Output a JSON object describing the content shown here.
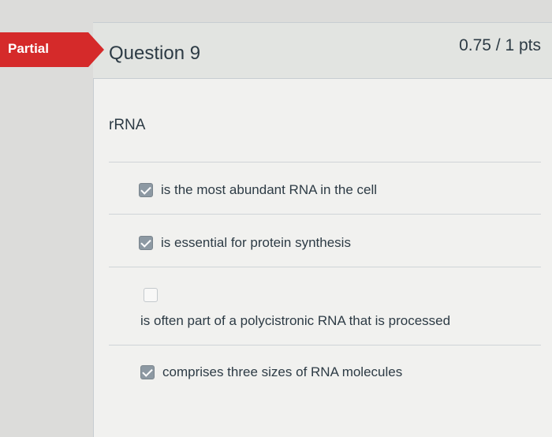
{
  "badge": {
    "label": "Partial"
  },
  "question": {
    "title": "Question 9",
    "points": "0.75 / 1 pts",
    "prompt": "rRNA",
    "answers": [
      {
        "text": "is the most abundant RNA in the cell",
        "checked": true
      },
      {
        "text": "is essential for protein synthesis",
        "checked": true
      },
      {
        "text": "is often part of a polycistronic RNA that is processed",
        "checked": false
      },
      {
        "text": "comprises three sizes of RNA molecules",
        "checked": true
      }
    ]
  },
  "colors": {
    "badge": "#d52a2a",
    "checked_box": "#8d99a3",
    "text": "#2d3b45"
  },
  "icons": {
    "checked": "checkmark-icon",
    "unchecked": "empty-checkbox-icon"
  }
}
